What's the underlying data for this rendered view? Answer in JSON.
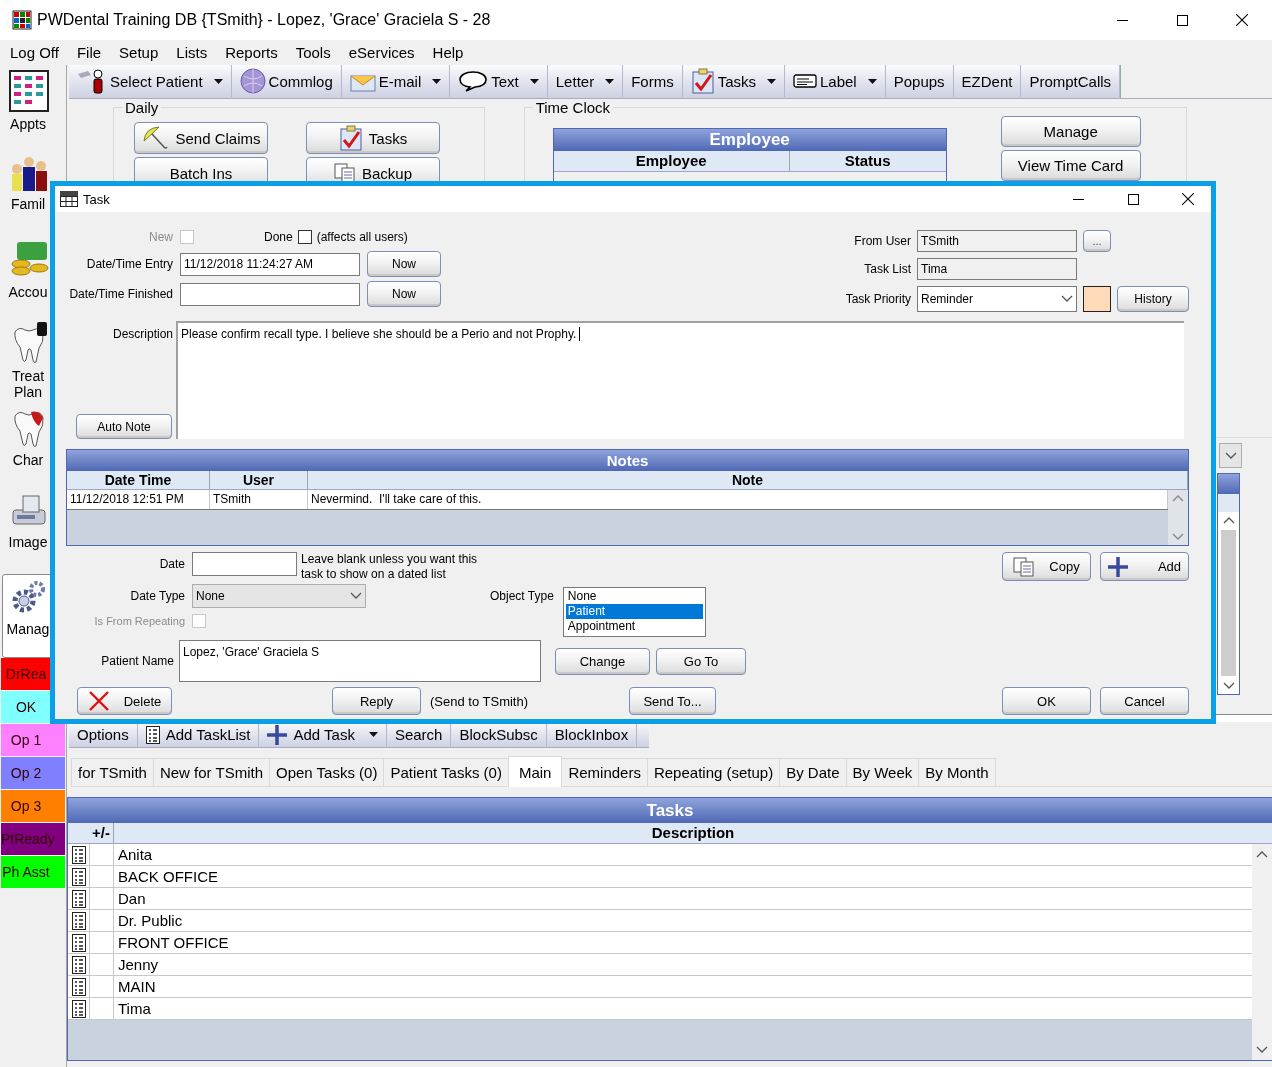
{
  "window": {
    "title": "PWDental Training DB {TSmith} - Lopez, 'Grace' Graciela S - 28"
  },
  "menu": [
    "Log Off",
    "File",
    "Setup",
    "Lists",
    "Reports",
    "Tools",
    "eServices",
    "Help"
  ],
  "sidebar": {
    "modules": [
      {
        "label": "Appts",
        "selected": false
      },
      {
        "label": "Famil",
        "selected": false
      },
      {
        "label": "Accou",
        "selected": false
      },
      {
        "label": "Treat Plan",
        "selected": false
      },
      {
        "label": "Char",
        "selected": false
      },
      {
        "label": "Image",
        "selected": false
      },
      {
        "label": "Manag",
        "selected": true
      }
    ],
    "status_buttons": [
      {
        "label": "DrRea",
        "color": "#ff0000"
      },
      {
        "label": "OK",
        "color": "#80ffff"
      },
      {
        "label": "Op 1",
        "color": "#ff80ff"
      },
      {
        "label": "Op 2",
        "color": "#8080ff"
      },
      {
        "label": "Op 3",
        "color": "#ff8000"
      },
      {
        "label": "PtReady",
        "color": "#800080"
      },
      {
        "label": "Ph Asst",
        "color": "#00ff00"
      }
    ]
  },
  "toolbar": [
    {
      "label": "Select Patient",
      "dropdown": true
    },
    {
      "label": "Commlog",
      "dropdown": false
    },
    {
      "label": "E-mail",
      "dropdown": true
    },
    {
      "label": "Text",
      "dropdown": true
    },
    {
      "label": "Letter",
      "dropdown": true
    },
    {
      "label": "Forms",
      "dropdown": false
    },
    {
      "label": "Tasks",
      "dropdown": true
    },
    {
      "label": "Label",
      "dropdown": true
    },
    {
      "label": "Popups",
      "dropdown": false
    },
    {
      "label": "EZDent",
      "dropdown": false
    },
    {
      "label": "PromptCalls",
      "dropdown": false
    }
  ],
  "daily": {
    "title": "Daily",
    "buttons": [
      "Send Claims",
      "Tasks",
      "Batch Ins",
      "Backup"
    ]
  },
  "time_clock": {
    "title": "Time Clock",
    "grid_title": "Employee",
    "columns": [
      "Employee",
      "Status"
    ],
    "buttons": [
      "Manage",
      "View Time Card"
    ]
  },
  "tasks": {
    "toolbar": [
      {
        "label": "Options",
        "dropdown": false
      },
      {
        "label": "Add TaskList",
        "dropdown": false
      },
      {
        "label": "Add Task",
        "dropdown": true
      },
      {
        "label": "Search",
        "dropdown": false
      },
      {
        "label": "BlockSubsc",
        "dropdown": false
      },
      {
        "label": "BlockInbox",
        "dropdown": false
      }
    ],
    "tabs": [
      {
        "label": "for TSmith",
        "selected": false
      },
      {
        "label": "New for TSmith",
        "selected": false
      },
      {
        "label": "Open Tasks (0)",
        "selected": false
      },
      {
        "label": "Patient Tasks (0)",
        "selected": false
      },
      {
        "label": "Main",
        "selected": true
      },
      {
        "label": "Reminders",
        "selected": false
      },
      {
        "label": "Repeating (setup)",
        "selected": false
      },
      {
        "label": "By Date",
        "selected": false
      },
      {
        "label": "By Week",
        "selected": false
      },
      {
        "label": "By Month",
        "selected": false
      }
    ],
    "grid": {
      "title": "Tasks",
      "columns": [
        "+/-",
        "Description"
      ],
      "rows": [
        "Anita",
        "BACK OFFICE",
        "Dan",
        "Dr. Public",
        "FRONT OFFICE",
        "Jenny",
        "MAIN",
        "Tima"
      ]
    }
  },
  "dialog": {
    "title": "Task",
    "new": {
      "label": "New",
      "checked": false,
      "disabled": true
    },
    "done": {
      "label": "Done",
      "checked": false,
      "disabled": false,
      "note": "(affects all users)"
    },
    "date_entry": {
      "label": "Date/Time Entry",
      "value": "11/12/2018 11:24:27 AM",
      "button": "Now"
    },
    "date_finished": {
      "label": "Date/Time Finished",
      "button": "Now"
    },
    "from_user": {
      "label": "From User",
      "value": "TSmith",
      "button": "..."
    },
    "task_list": {
      "label": "Task List",
      "value": "Tima"
    },
    "task_priority": {
      "label": "Task Priority",
      "value": "Reminder",
      "color": "#ffdab9"
    },
    "history_button": "History",
    "description": {
      "label": "Description",
      "value": "Please confirm recall type. I believe she should be a Perio and not Prophy."
    },
    "auto_note_button": "Auto Note",
    "notes": {
      "title": "Notes",
      "columns": [
        "Date Time",
        "User",
        "Note"
      ],
      "rows": [
        [
          "11/12/2018 12:51 PM",
          "TSmith",
          "Nevermind.  I'll take care of this."
        ]
      ]
    },
    "date": {
      "label": "Date",
      "hint": "Leave blank unless you want this task to show on a dated list"
    },
    "date_type": {
      "label": "Date Type",
      "value": "None"
    },
    "is_from_repeating": {
      "label": "Is From Repeating",
      "checked": false,
      "disabled": true
    },
    "object_type": {
      "label": "Object Type",
      "options": [
        {
          "label": "None",
          "selected": false
        },
        {
          "label": "Patient",
          "selected": true
        },
        {
          "label": "Appointment",
          "selected": false
        }
      ]
    },
    "patient_name": {
      "label": "Patient Name",
      "value": "Lopez, 'Grace' Graciela S"
    },
    "copy_button": "Copy",
    "add_button": "Add",
    "change_button": "Change",
    "go_to_button": "Go To",
    "delete_button": "Delete",
    "reply_button": "Reply",
    "reply_note": "(Send to TSmith)",
    "send_to_button": "Send To...",
    "ok_button": "OK",
    "cancel_button": "Cancel"
  }
}
